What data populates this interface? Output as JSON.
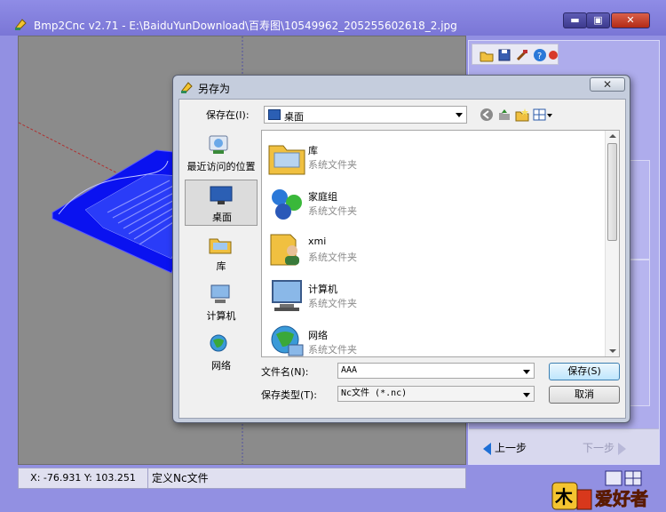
{
  "app": {
    "title": "Bmp2Cnc v2.71 - E:\\BaiduYunDownload\\百寿图\\10549962_205255602618_2.jpg",
    "window_buttons": {
      "minimize": "▬",
      "maximize": "▣",
      "close": "✕"
    }
  },
  "status": {
    "coords": "X: -76.931  Y: 103.251",
    "message": "定义Nc文件"
  },
  "right_panel": {
    "prev": "上一步",
    "next": "下一步",
    "tools": [
      "open-icon",
      "save-icon",
      "tool-icon",
      "help-icon",
      "close-icon"
    ]
  },
  "dialog": {
    "title": "另存为",
    "close": "✕",
    "save_in_label": "保存在(I):",
    "save_in_value": "桌面",
    "places": [
      {
        "label": "最近访问的位置",
        "icon": "recent-places-icon"
      },
      {
        "label": "桌面",
        "icon": "desktop-icon"
      },
      {
        "label": "库",
        "icon": "libraries-icon"
      },
      {
        "label": "计算机",
        "icon": "computer-icon"
      },
      {
        "label": "网络",
        "icon": "network-icon"
      }
    ],
    "files": [
      {
        "name": "库",
        "type": "系统文件夹",
        "icon": "libraries-icon"
      },
      {
        "name": "家庭组",
        "type": "系统文件夹",
        "icon": "homegroup-icon"
      },
      {
        "name": "xmi",
        "type": "系统文件夹",
        "icon": "user-folder-icon"
      },
      {
        "name": "计算机",
        "type": "系统文件夹",
        "icon": "computer-icon"
      },
      {
        "name": "网络",
        "type": "系统文件夹",
        "icon": "network-icon"
      }
    ],
    "filename_label": "文件名(N):",
    "filename_value": "AAA",
    "filetype_label": "保存类型(T):",
    "filetype_value": "Nc文件 (*.nc)",
    "save_button": "保存(S)",
    "cancel_button": "取消"
  },
  "watermark": {
    "text": "木工爱好者"
  },
  "colors": {
    "title_bar": "#7a76d6",
    "model_blue": "#0a12f0",
    "viewport_bg": "#8b8b8b",
    "accent": "#1e6fd6"
  }
}
